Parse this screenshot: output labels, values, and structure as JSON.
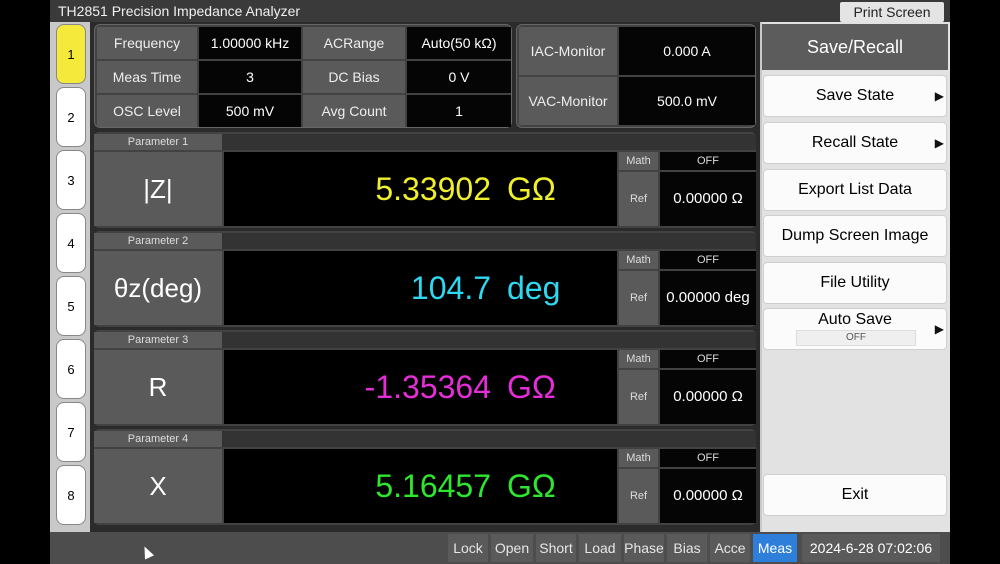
{
  "title": "TH2851 Precision Impedance Analyzer",
  "print_screen": "Print Screen",
  "tabs": [
    "1",
    "2",
    "3",
    "4",
    "5",
    "6",
    "7",
    "8"
  ],
  "active_tab": "1",
  "meas_params": {
    "frequency_label": "Frequency",
    "frequency_value": "1.00000 kHz",
    "acrange_label": "ACRange",
    "acrange_value": "Auto(50 kΩ)",
    "meas_time_label": "Meas Time",
    "meas_time_value": "3",
    "dc_bias_label": "DC Bias",
    "dc_bias_value": "0 V",
    "osc_level_label": "OSC Level",
    "osc_level_value": "500 mV",
    "avg_count_label": "Avg Count",
    "avg_count_value": "1"
  },
  "monitor": {
    "iac_label": "IAC-Monitor",
    "iac_value": "0.000 A",
    "vac_label": "VAC-Monitor",
    "vac_value": "500.0 mV"
  },
  "parameters": [
    {
      "title": "Parameter 1",
      "name": "|Z|",
      "value": "5.33902",
      "unit": "GΩ",
      "color": "#f0ef2e",
      "math_label": "Math",
      "math_value": "OFF",
      "ref_label": "Ref",
      "ref_value": "0.00000 Ω"
    },
    {
      "title": "Parameter 2",
      "name": "θz(deg)",
      "value": "104.7",
      "unit": "deg",
      "color": "#2ed8f0",
      "math_label": "Math",
      "math_value": "OFF",
      "ref_label": "Ref",
      "ref_value": "0.00000 deg"
    },
    {
      "title": "Parameter 3",
      "name": "R",
      "value": "-1.35364",
      "unit": "GΩ",
      "color": "#e62ed8",
      "math_label": "Math",
      "math_value": "OFF",
      "ref_label": "Ref",
      "ref_value": "0.00000 Ω"
    },
    {
      "title": "Parameter 4",
      "name": "X",
      "value": "5.16457",
      "unit": "GΩ",
      "color": "#2ee62e",
      "math_label": "Math",
      "math_value": "OFF",
      "ref_label": "Ref",
      "ref_value": "0.00000 Ω"
    }
  ],
  "side": {
    "title": "Save/Recall",
    "save_state": "Save State",
    "recall_state": "Recall State",
    "export_list": "Export List Data",
    "dump_screen": "Dump Screen Image",
    "file_utility": "File Utility",
    "auto_save": "Auto Save",
    "auto_save_value": "OFF",
    "exit": "Exit",
    "arrow": "▶"
  },
  "statusbar": {
    "items": [
      "Lock",
      "Open",
      "Short",
      "Load",
      "Phase",
      "Bias",
      "Acce",
      "Meas"
    ],
    "active": "Meas",
    "datetime": "2024-6-28 07:02:06"
  }
}
